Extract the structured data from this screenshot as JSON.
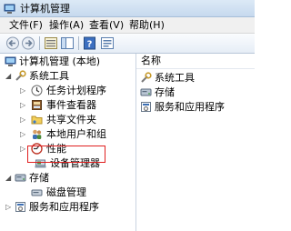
{
  "window": {
    "title": "计算机管理"
  },
  "menu": [
    "文件(F)",
    "操作(A)",
    "查看(V)",
    "帮助(H)"
  ],
  "toolbar": {
    "buttons": [
      "back-icon",
      "forward-icon",
      "up-icon",
      "show-hide-tree-icon",
      "help-icon",
      "properties-icon"
    ]
  },
  "tree": {
    "root": "计算机管理 (本地)",
    "system_tools": "系统工具",
    "task_scheduler": "任务计划程序",
    "event_viewer": "事件查看器",
    "shared_folders": "共享文件夹",
    "local_users": "本地用户和组",
    "performance": "性能",
    "device_manager": "设备管理器",
    "storage": "存储",
    "disk_management": "磁盘管理",
    "services_apps": "服务和应用程序"
  },
  "list": {
    "column": "名称",
    "items": [
      "系统工具",
      "存储",
      "服务和应用程序"
    ]
  },
  "colors": {
    "highlight_border": "#e02020"
  }
}
